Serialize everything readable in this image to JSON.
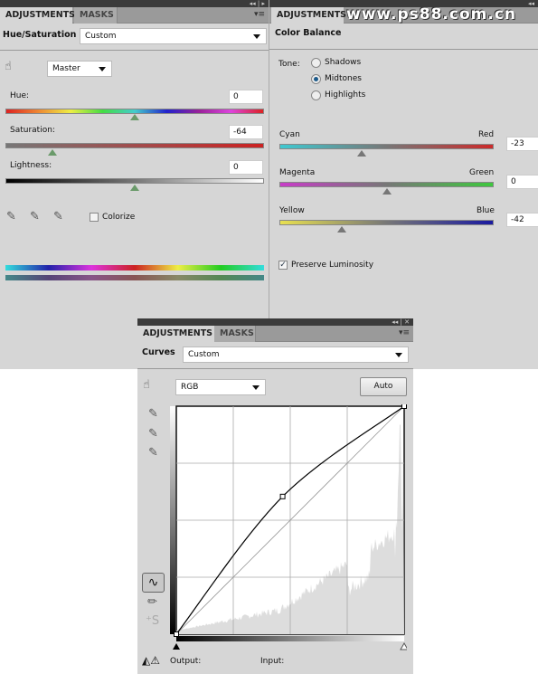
{
  "hue_saturation": {
    "tabs": [
      "ADJUSTMENTS",
      "MASKS"
    ],
    "title": "Hue/Saturation",
    "preset": "Custom",
    "channel": "Master",
    "hue": {
      "label": "Hue:",
      "value": "0"
    },
    "saturation": {
      "label": "Saturation:",
      "value": "-64"
    },
    "lightness": {
      "label": "Lightness:",
      "value": "0"
    },
    "colorize": {
      "label": "Colorize",
      "checked": false
    },
    "icons": [
      "targeted-adjustment-icon",
      "eyedropper-icon",
      "eyedropper-plus-icon",
      "eyedropper-minus-icon"
    ]
  },
  "color_balance": {
    "tab": "ADJUSTMENTS",
    "watermark": "www.ps88.com.cn",
    "title": "Color Balance",
    "tone_label": "Tone:",
    "tones": [
      {
        "label": "Shadows",
        "selected": false
      },
      {
        "label": "Midtones",
        "selected": true
      },
      {
        "label": "Highlights",
        "selected": false
      }
    ],
    "sliders": [
      {
        "left": "Cyan",
        "right": "Red",
        "value": "-23",
        "left_color": "#3ec8d0",
        "right_color": "#cc2a2a"
      },
      {
        "left": "Magenta",
        "right": "Green",
        "value": "0",
        "left_color": "#c83cc8",
        "right_color": "#3ec83e"
      },
      {
        "left": "Yellow",
        "right": "Blue",
        "value": "-42",
        "left_color": "#e8e050",
        "right_color": "#1a1aa0"
      }
    ],
    "preserve_luminosity": {
      "label": "Preserve Luminosity",
      "checked": true
    }
  },
  "curves": {
    "tabs": [
      "ADJUSTMENTS",
      "MASKS"
    ],
    "title": "Curves",
    "preset": "Custom",
    "channel": "RGB",
    "auto_label": "Auto",
    "output_label": "Output:",
    "input_label": "Input:",
    "points": [
      [
        0,
        0
      ],
      [
        119,
        154
      ],
      [
        255,
        255
      ]
    ]
  }
}
